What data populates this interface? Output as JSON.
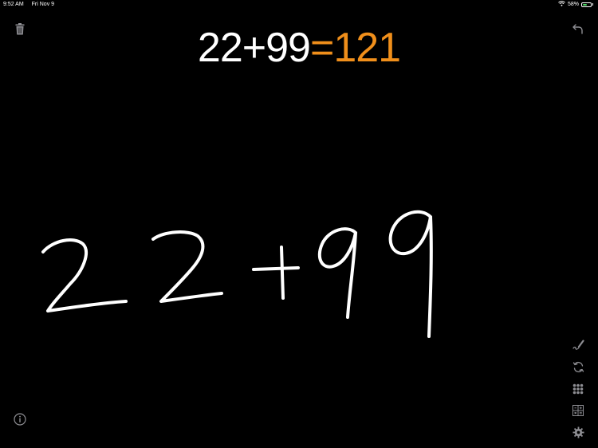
{
  "status_bar": {
    "time": "9:52 AM",
    "date": "Fri Nov 9",
    "battery_percent": "58%",
    "battery_level": 0.58
  },
  "equation": {
    "expression": "22+99",
    "equals": "=",
    "result": "121"
  },
  "handwriting": {
    "content": "22+99"
  },
  "icons": {
    "trash": "trash-icon",
    "undo": "undo-icon",
    "pen": "pen-icon",
    "refresh": "refresh-icon",
    "keypad": "keypad-icon",
    "converter": "grid-calculator-icon",
    "settings": "gear-icon",
    "info": "info-icon"
  },
  "colors": {
    "background": "#000000",
    "expression": "#ffffff",
    "result": "#f08f1b",
    "icon": "#8e8e93",
    "battery": "#4cd964"
  }
}
